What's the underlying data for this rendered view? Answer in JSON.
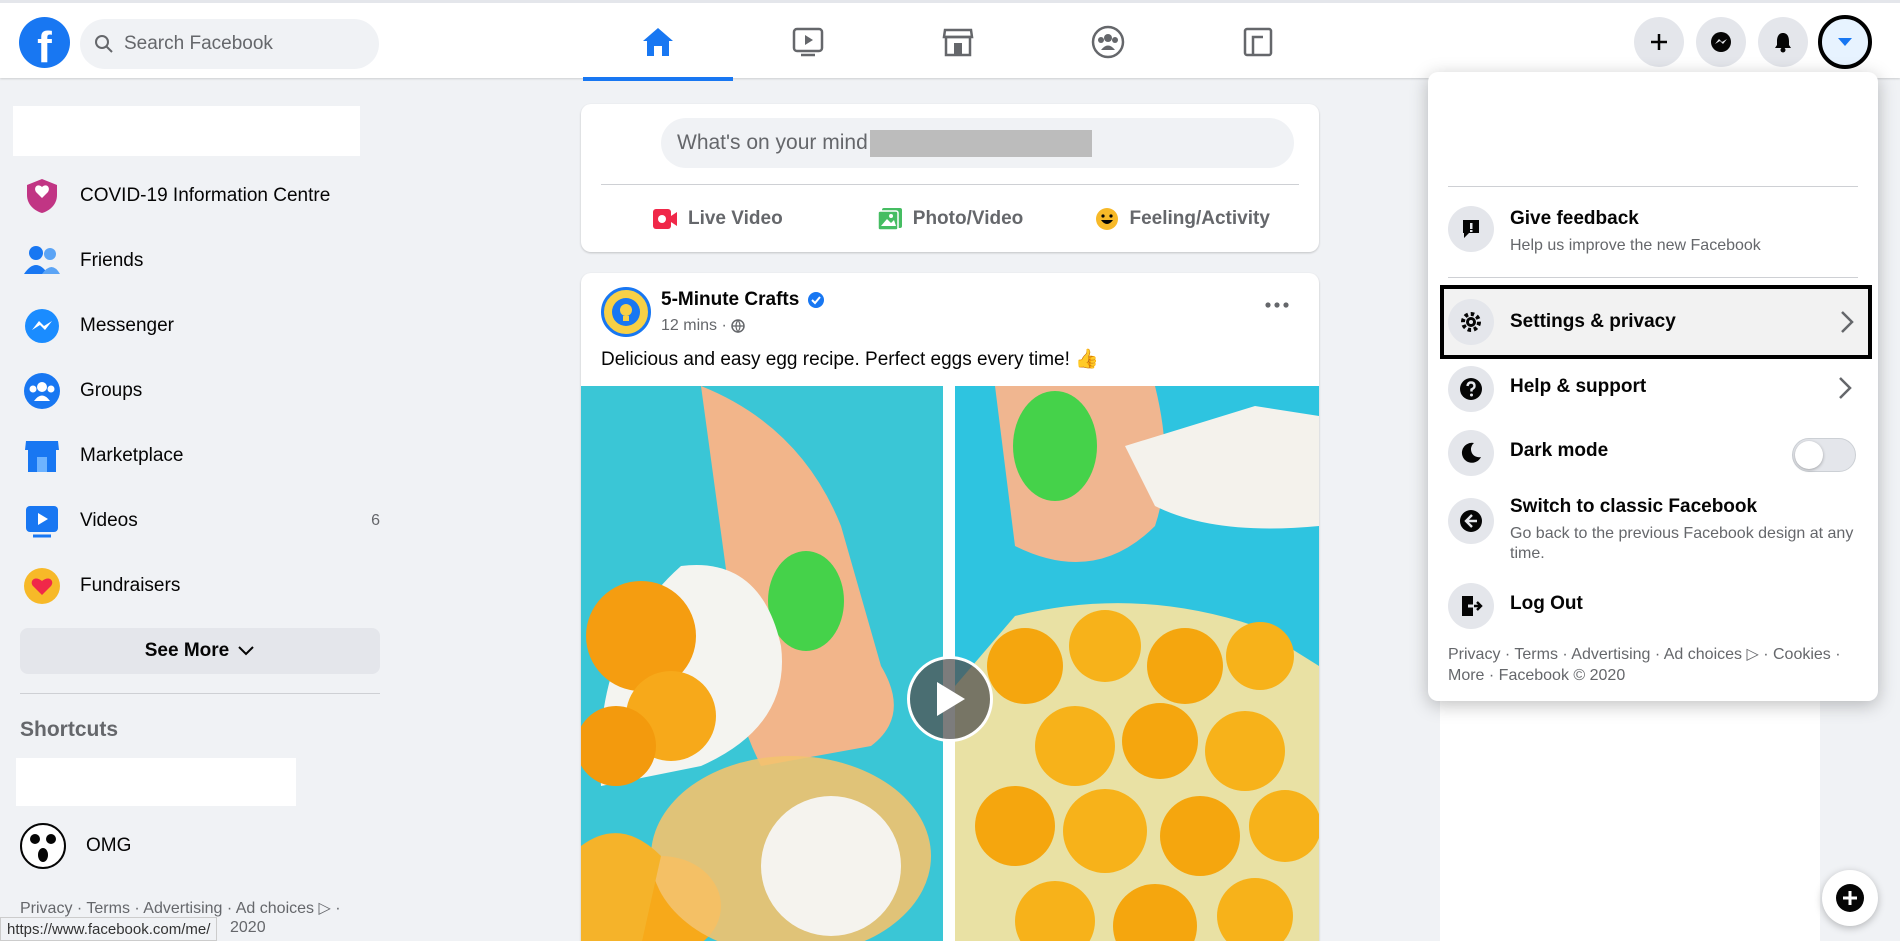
{
  "header": {
    "search_placeholder": "Search Facebook"
  },
  "sidebar": {
    "items": [
      {
        "label": "COVID-19 Information Centre",
        "icon": "covid-shield-icon"
      },
      {
        "label": "Friends",
        "icon": "friends-icon"
      },
      {
        "label": "Messenger",
        "icon": "messenger-icon"
      },
      {
        "label": "Groups",
        "icon": "groups-icon"
      },
      {
        "label": "Marketplace",
        "icon": "marketplace-icon"
      },
      {
        "label": "Videos",
        "icon": "videos-icon",
        "count": "6"
      },
      {
        "label": "Fundraisers",
        "icon": "fundraisers-icon"
      }
    ],
    "see_more": "See More",
    "shortcuts_title": "Shortcuts",
    "shortcut_omg": "OMG",
    "footer_line1": "Privacy · Terms · Advertising · Ad choices ▷ ·",
    "footer_line2": "2020"
  },
  "status_bar_url": "https://www.facebook.com/me/",
  "composer": {
    "prompt": "What's on your mind",
    "actions": [
      {
        "label": "Live Video",
        "color": "#f02849"
      },
      {
        "label": "Photo/Video",
        "color": "#45bd62"
      },
      {
        "label": "Feeling/Activity",
        "color": "#f7b928"
      }
    ]
  },
  "post": {
    "author": "5-Minute Crafts",
    "time": "12 mins ·",
    "text": "Delicious and easy egg recipe. Perfect eggs every time! 👍"
  },
  "menu": {
    "give_feedback_title": "Give feedback",
    "give_feedback_sub": "Help us improve the new Facebook",
    "settings_privacy": "Settings & privacy",
    "help_support": "Help & support",
    "dark_mode": "Dark mode",
    "dark_mode_on": false,
    "switch_classic_title": "Switch to classic Facebook",
    "switch_classic_sub": "Go back to the previous Facebook design at any time.",
    "log_out": "Log Out",
    "footer": "Privacy · Terms · Advertising · Ad choices ▷ · Cookies · More · Facebook © 2020"
  },
  "colors": {
    "brand": "#1877f2",
    "background": "#f0f2f5"
  }
}
